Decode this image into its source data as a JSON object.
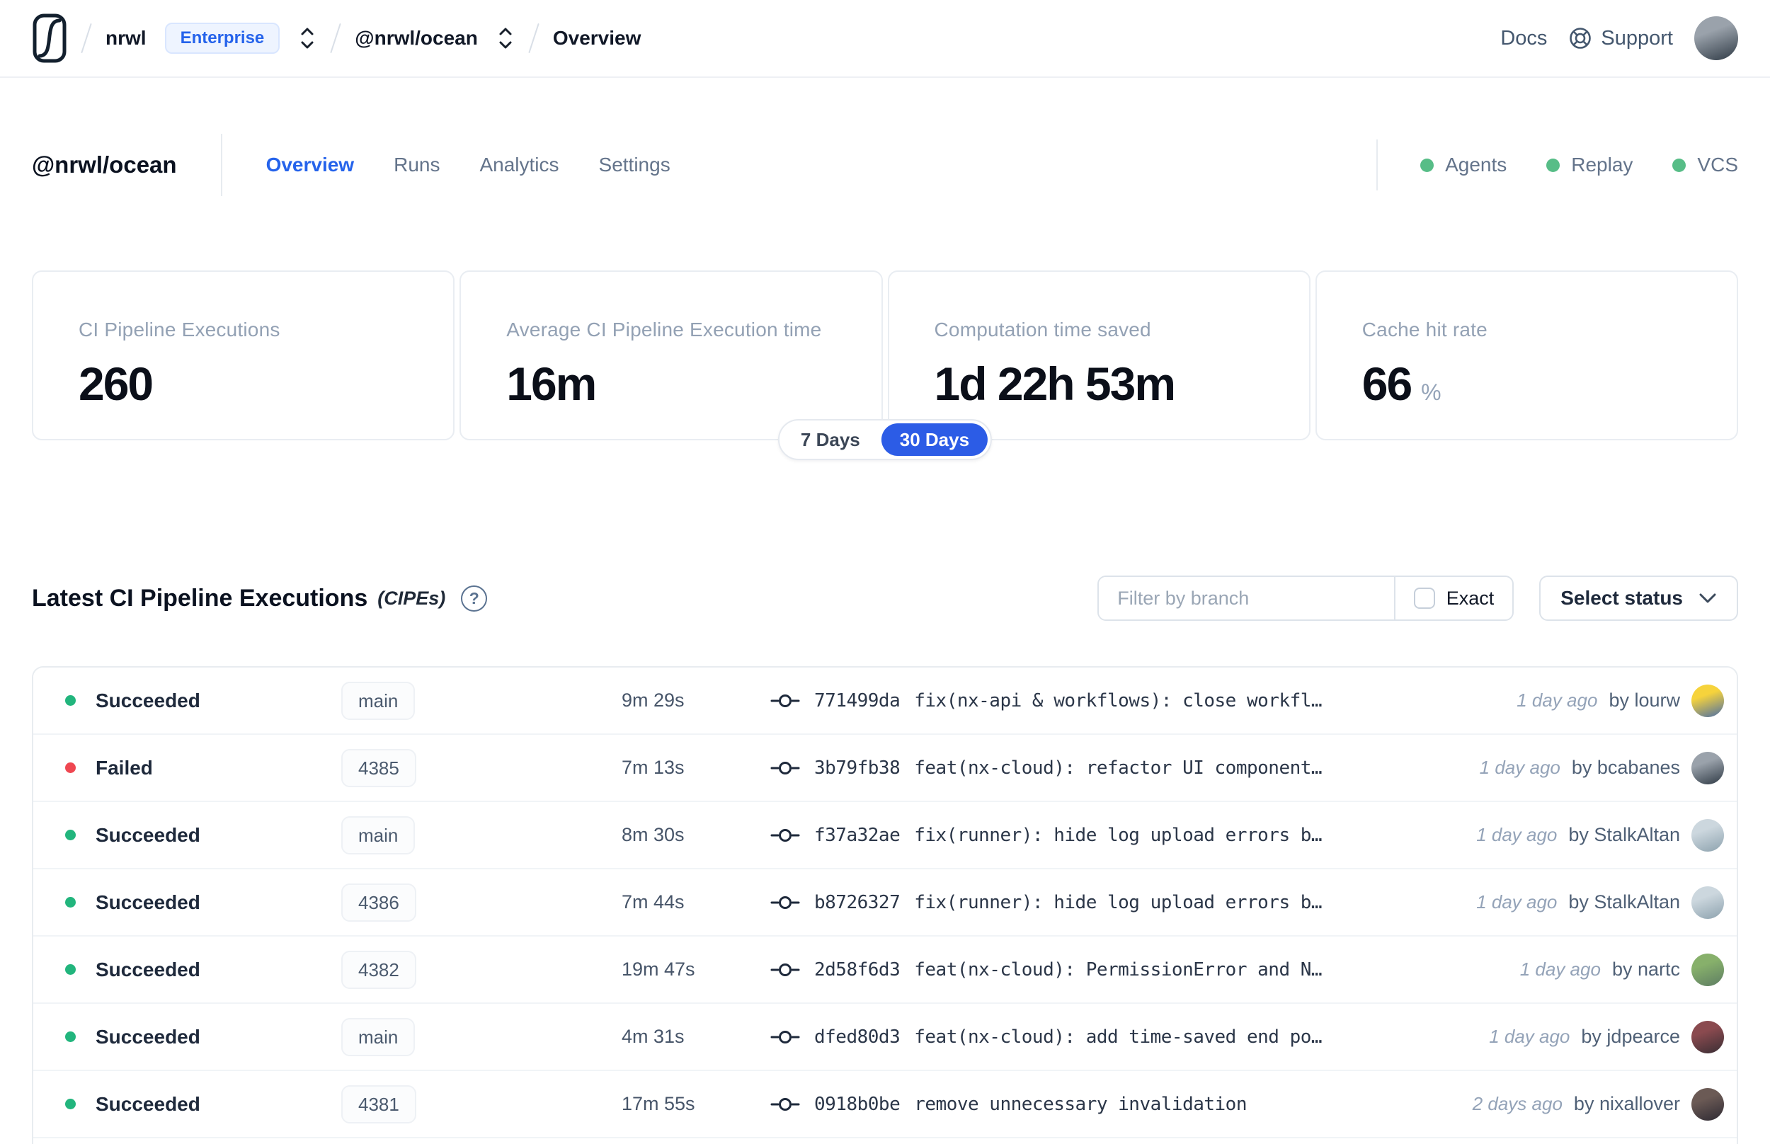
{
  "topbar": {
    "org": "nrwl",
    "badge": "Enterprise",
    "workspace": "@nrwl/ocean",
    "page": "Overview",
    "docs": "Docs",
    "support": "Support",
    "avatar_colors": [
      "#9aa2ab",
      "#2f3a45"
    ]
  },
  "header": {
    "title": "@nrwl/ocean",
    "tabs": [
      {
        "label": "Overview",
        "active": true
      },
      {
        "label": "Runs",
        "active": false
      },
      {
        "label": "Analytics",
        "active": false
      },
      {
        "label": "Settings",
        "active": false
      }
    ],
    "indicators": [
      {
        "label": "Agents"
      },
      {
        "label": "Replay"
      },
      {
        "label": "VCS"
      }
    ],
    "indicator_color": "#57bd87"
  },
  "stats": [
    {
      "label": "CI Pipeline Executions",
      "value": "260",
      "suffix": ""
    },
    {
      "label": "Average CI Pipeline Execution time",
      "value": "16m",
      "suffix": ""
    },
    {
      "label": "Computation time saved",
      "value": "1d 22h 53m",
      "suffix": ""
    },
    {
      "label": "Cache hit rate",
      "value": "66",
      "suffix": "%"
    }
  ],
  "range_toggle": {
    "accent": "#2c5ce6",
    "options": [
      {
        "label": "7 Days",
        "selected": false
      },
      {
        "label": "30 Days",
        "selected": true
      }
    ]
  },
  "cipes": {
    "title": "Latest CI Pipeline Executions",
    "subtitle": "(CIPEs)",
    "help_glyph": "?",
    "filter_placeholder": "Filter by branch",
    "exact_label": "Exact",
    "exact_checked": false,
    "status_button": "Select status"
  },
  "table": {
    "rows": [
      {
        "status": "Succeeded",
        "color": "#22b57d",
        "branch": "main",
        "duration": "9m 29s",
        "hash": "771499da",
        "message": "fix(nx-api & workflows): close workfl…",
        "time": "1 day ago",
        "author": "by lourw",
        "avatar": [
          "#f6d33c",
          "#4a6da7"
        ]
      },
      {
        "status": "Failed",
        "color": "#ef4751",
        "branch": "4385",
        "duration": "7m 13s",
        "hash": "3b79fb38",
        "message": "feat(nx-cloud): refactor UI component…",
        "time": "1 day ago",
        "author": "by bcabanes",
        "avatar": [
          "#9aa2ab",
          "#2f3a45"
        ]
      },
      {
        "status": "Succeeded",
        "color": "#22b57d",
        "branch": "main",
        "duration": "8m 30s",
        "hash": "f37a32ae",
        "message": "fix(runner): hide log upload errors b…",
        "time": "1 day ago",
        "author": "by StalkAltan",
        "avatar": [
          "#ccd7de",
          "#8da2ae"
        ]
      },
      {
        "status": "Succeeded",
        "color": "#22b57d",
        "branch": "4386",
        "duration": "7m 44s",
        "hash": "b8726327",
        "message": "fix(runner): hide log upload errors b…",
        "time": "1 day ago",
        "author": "by StalkAltan",
        "avatar": [
          "#ccd7de",
          "#8da2ae"
        ]
      },
      {
        "status": "Succeeded",
        "color": "#22b57d",
        "branch": "4382",
        "duration": "19m 47s",
        "hash": "2d58f6d3",
        "message": "feat(nx-cloud): PermissionError and N…",
        "time": "1 day ago",
        "author": "by nartc",
        "avatar": [
          "#87b06b",
          "#5e7d63"
        ]
      },
      {
        "status": "Succeeded",
        "color": "#22b57d",
        "branch": "main",
        "duration": "4m 31s",
        "hash": "dfed80d3",
        "message": "feat(nx-cloud): add time-saved end po…",
        "time": "1 day ago",
        "author": "by jdpearce",
        "avatar": [
          "#8a4a4f",
          "#392e34"
        ]
      },
      {
        "status": "Succeeded",
        "color": "#22b57d",
        "branch": "4381",
        "duration": "17m 55s",
        "hash": "0918b0be",
        "message": "remove unnecessary invalidation",
        "time": "2 days ago",
        "author": "by nixallover",
        "avatar": [
          "#6b5a55",
          "#2e2a33"
        ]
      }
    ]
  }
}
